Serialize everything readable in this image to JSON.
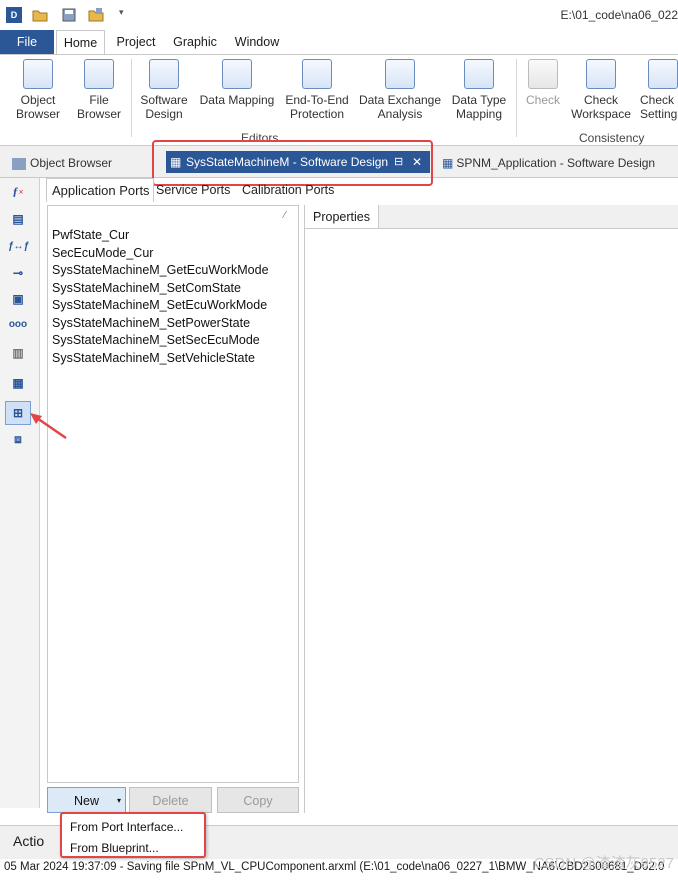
{
  "titlebar": {
    "path": "E:\\01_code\\na06_022"
  },
  "menu": {
    "file": "File",
    "home": "Home",
    "project": "Project",
    "graphic": "Graphic",
    "window": "Window"
  },
  "ribbon": {
    "object_browser": "Object Browser",
    "file_browser": "File Browser",
    "software_design": "Software Design",
    "data_mapping": "Data Mapping",
    "end_to_end": "End-To-End Protection",
    "data_exchange": "Data Exchange Analysis",
    "data_type_mapping": "Data Type Mapping",
    "check": "Check",
    "check_workspace": "Check Workspace",
    "check_settings": "Check Settings",
    "group_editors": "Editors",
    "group_consistency": "Consistency"
  },
  "doctabs": {
    "object_browser": "Object Browser",
    "active": "SysStateMachineM - Software Design",
    "spnm": "SPNM_Application - Software Design"
  },
  "porttabs": {
    "application": "Application Ports",
    "service": "Service Ports",
    "calibration": "Calibration Ports"
  },
  "ports": [
    "PwfState_Cur",
    "SecEcuMode_Cur",
    "SysStateMachineM_GetEcuWorkMode",
    "SysStateMachineM_SetComState",
    "SysStateMachineM_SetEcuWorkMode",
    "SysStateMachineM_SetPowerState",
    "SysStateMachineM_SetSecEcuMode",
    "SysStateMachineM_SetVehicleState"
  ],
  "buttons": {
    "new": "New",
    "delete": "Delete",
    "copy": "Copy"
  },
  "properties": {
    "tab": "Properties"
  },
  "dropdown": {
    "from_port_interface": "From Port Interface...",
    "from_blueprint": "From Blueprint..."
  },
  "action": {
    "label": "Actio"
  },
  "log": {
    "line": "05 Mar 2024 19:37:09 - Saving file SPnM_VL_CPUComponent.arxml (E:\\01_code\\na06_0227_1\\BMW_NA6\\CBD2300681_D02.0"
  },
  "watermark": "CSDN @渣渣灰9527",
  "colors": {
    "accent": "#2b5797",
    "highlight": "#e04646"
  }
}
